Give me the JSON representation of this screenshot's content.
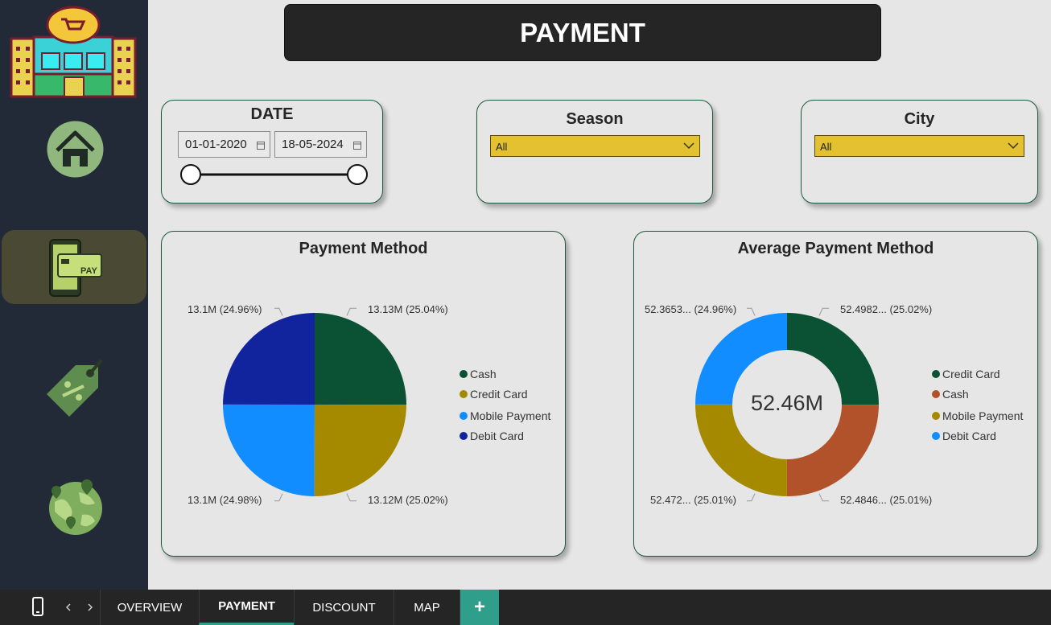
{
  "header": {
    "title": "PAYMENT"
  },
  "sidebar": {
    "items": [
      {
        "name": "home",
        "icon": "home-icon"
      },
      {
        "name": "payment",
        "icon": "pay-icon",
        "label": "PAY",
        "active": true
      },
      {
        "name": "discount",
        "icon": "discount-tag-icon"
      },
      {
        "name": "map",
        "icon": "globe-map-icon"
      }
    ]
  },
  "filters": {
    "date": {
      "title": "DATE",
      "start": "01-01-2020",
      "end": "18-05-2024"
    },
    "season": {
      "title": "Season",
      "value": "All"
    },
    "city": {
      "title": "City",
      "value": "All"
    }
  },
  "charts": {
    "payment_method": {
      "title": "Payment Method",
      "labels": {
        "top_right": "13.13M (25.04%)",
        "top_left": "13.1M (24.96%)",
        "bottom_right": "13.12M (25.02%)",
        "bottom_left": "13.1M (24.98%)"
      },
      "legend": [
        "Cash",
        "Credit Card",
        "Mobile Payment",
        "Debit Card"
      ]
    },
    "average_payment_method": {
      "title": "Average Payment Method",
      "center_value": "52.46M",
      "labels": {
        "top_right": "52.4982... (25.02%)",
        "top_left": "52.3653... (24.96%)",
        "bottom_right": "52.4846... (25.01%)",
        "bottom_left": "52.472... (25.01%)"
      },
      "legend": [
        "Credit Card",
        "Cash",
        "Mobile Payment",
        "Debit Card"
      ]
    }
  },
  "chart_data": [
    {
      "type": "pie",
      "title": "Payment Method",
      "categories": [
        "Cash",
        "Credit Card",
        "Mobile Payment",
        "Debit Card"
      ],
      "values": [
        13.13,
        13.12,
        13.1,
        13.1
      ],
      "percent": [
        25.04,
        25.02,
        24.98,
        24.96
      ],
      "unit": "M",
      "colors": [
        "#0b5134",
        "#a58a00",
        "#118dff",
        "#12239e"
      ]
    },
    {
      "type": "pie",
      "title": "Average Payment Method",
      "donut": true,
      "center_label": "52.46M",
      "categories": [
        "Credit Card",
        "Cash",
        "Mobile Payment",
        "Debit Card"
      ],
      "values": [
        52.4982,
        52.4846,
        52.472,
        52.3653
      ],
      "percent": [
        25.02,
        25.01,
        25.01,
        24.96
      ],
      "unit": "M",
      "colors": [
        "#0b5134",
        "#b1522a",
        "#a58a00",
        "#118dff"
      ]
    }
  ],
  "bottom_bar": {
    "tabs": [
      "OVERVIEW",
      "PAYMENT",
      "DISCOUNT",
      "MAP"
    ],
    "active_tab": "PAYMENT",
    "add_label": "+"
  }
}
